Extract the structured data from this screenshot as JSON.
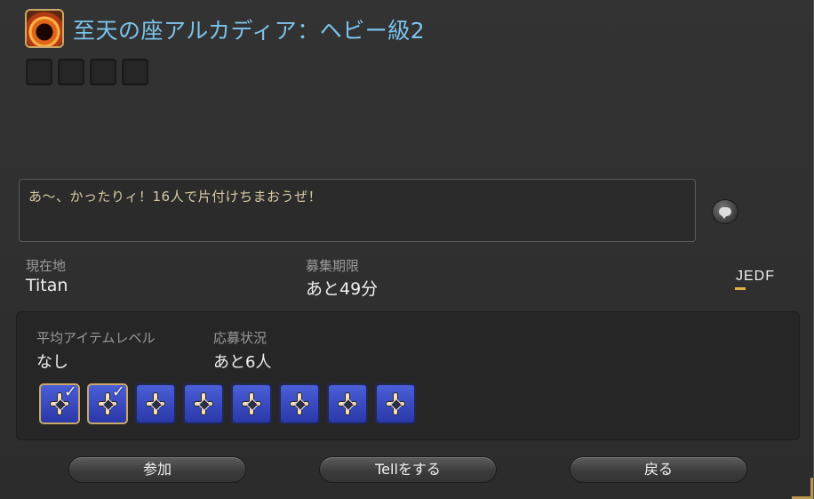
{
  "header": {
    "title": "至天の座アルカディア：ヘビー級2"
  },
  "comment": "あ～、かったりィ！16人で片付けちまおうぜ！",
  "info": {
    "location_label": "現在地",
    "location_value": "Titan",
    "expiry_label": "募集期限",
    "expiry_value": "あと49分",
    "languages": "JEDF"
  },
  "party": {
    "ilvl_label": "平均アイテムレベル",
    "ilvl_value": "なし",
    "status_label": "応募状況",
    "status_value": "あと6人",
    "slots_filled": 2,
    "slots_total": 8
  },
  "buttons": {
    "join": "参加",
    "tell": "Tellをする",
    "back": "戻る"
  },
  "colors": {
    "title": "#7cc3ea",
    "comment_text": "#d7c9a4",
    "job_slot": "#3a4ac4",
    "accent_gold": "#c9a86a"
  },
  "icons": [
    "duty-icon",
    "chat-bubble-icon",
    "job-slot-icon",
    "checkmark-icon"
  ]
}
